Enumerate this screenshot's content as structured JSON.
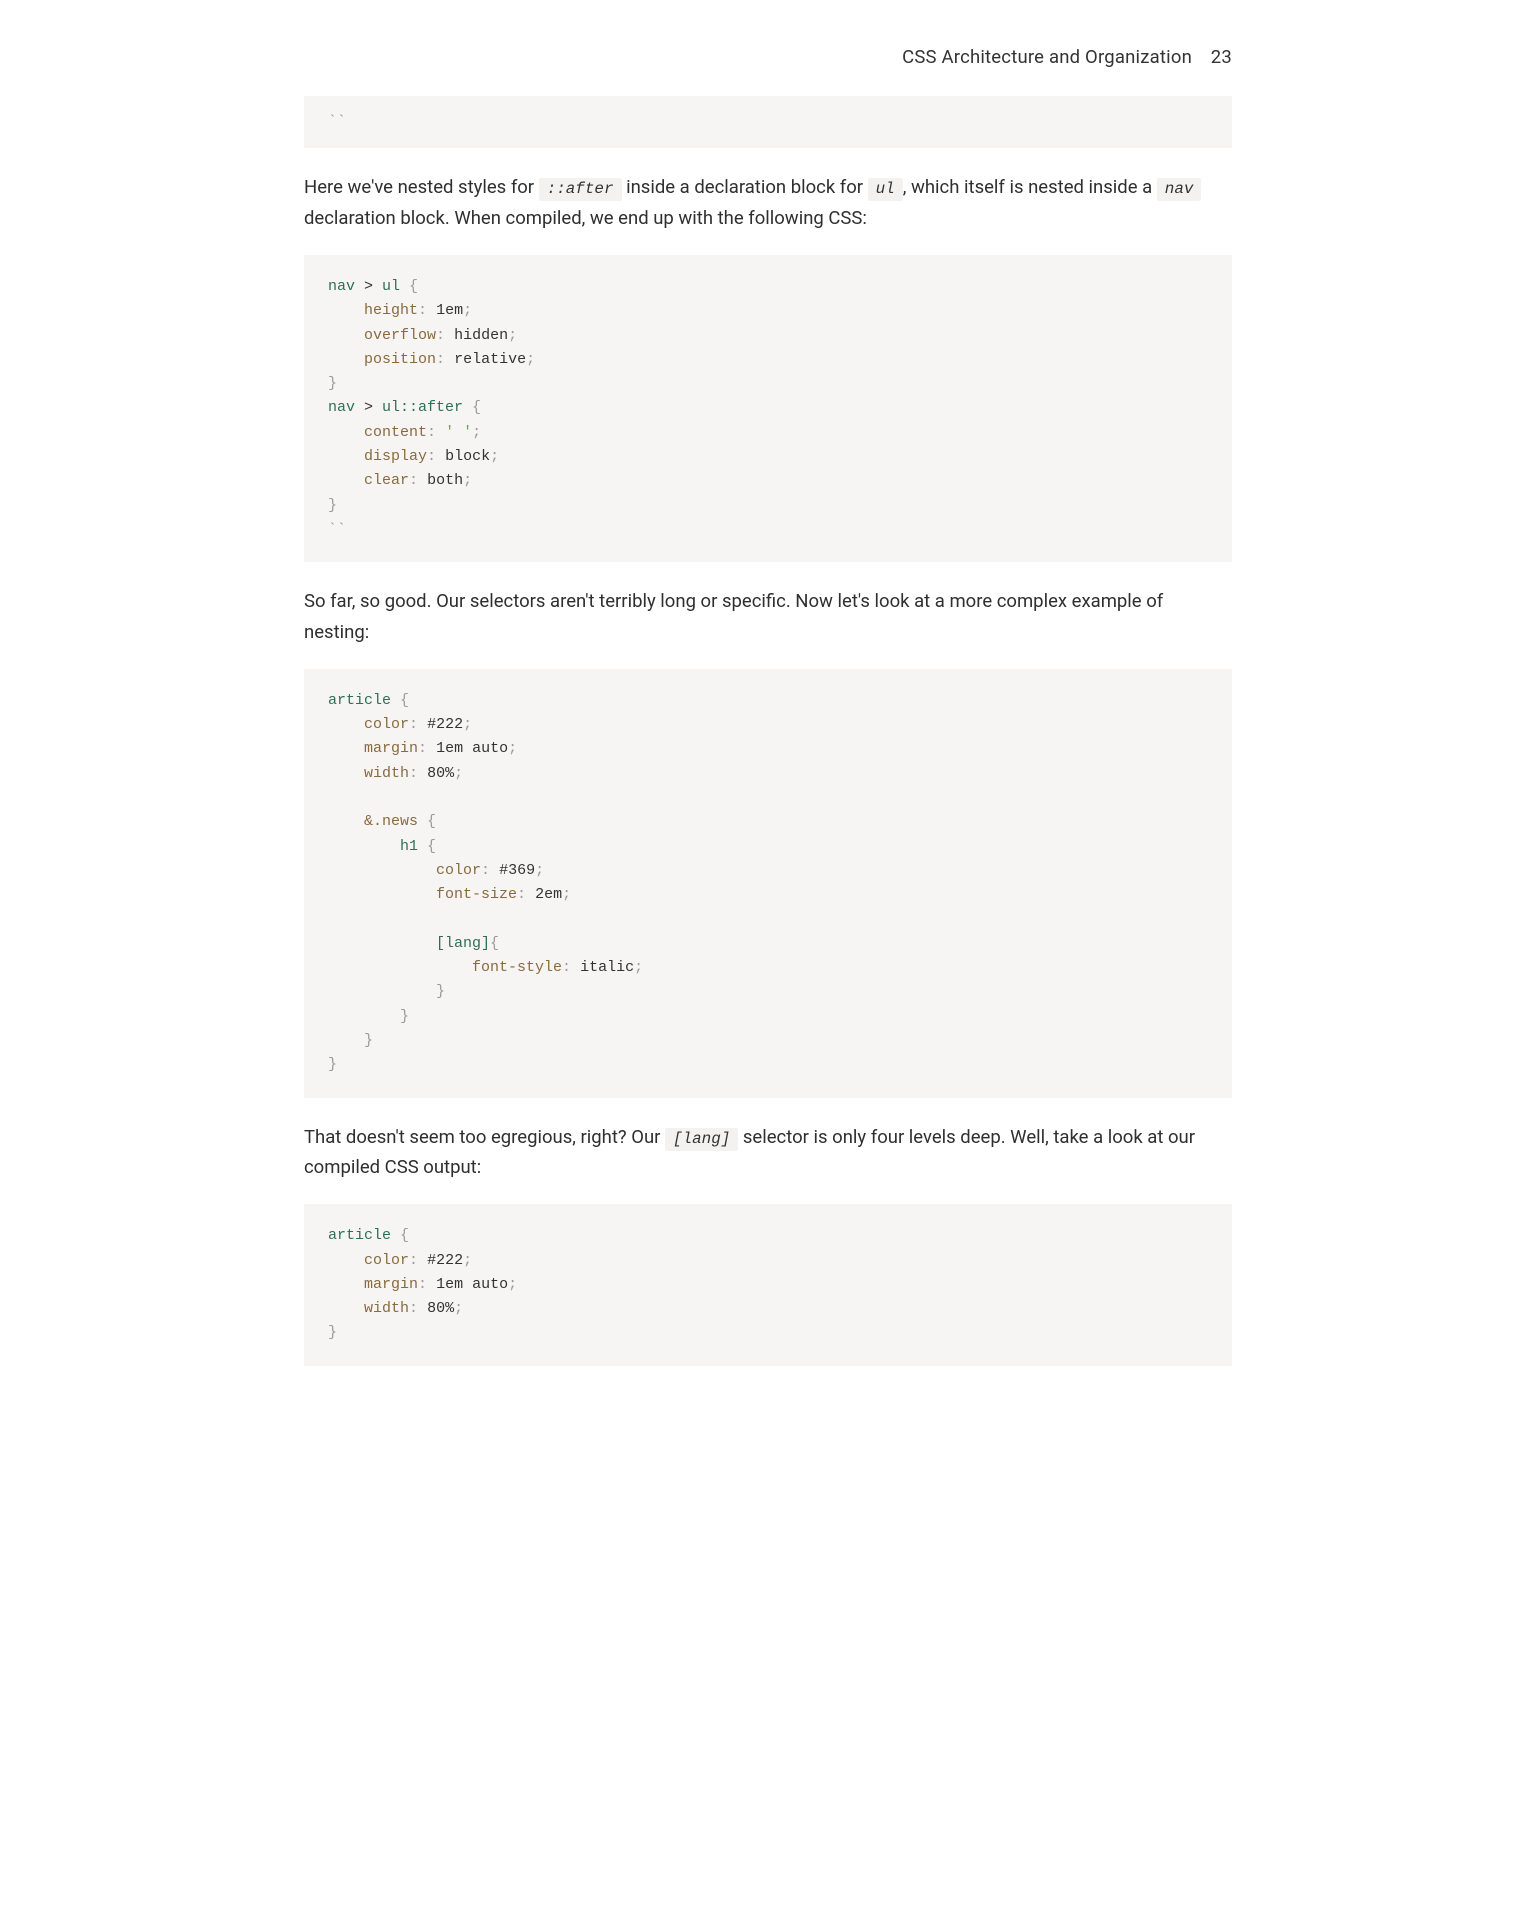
{
  "header": {
    "title": "CSS Architecture and Organization",
    "page_number": "23"
  },
  "block0_backticks": "``",
  "para1": {
    "t1": "Here we've nested styles for ",
    "c1": "::after",
    "t2": " inside a declaration block for ",
    "c2": "ul",
    "t3": ", which itself is nested inside a ",
    "c3": "nav",
    "t4": " declaration block. When compiled, we end up with the following CSS:"
  },
  "code1": {
    "sel1_a": "nav",
    "sel1_op": " > ",
    "sel1_b": "ul",
    "brace_o": " {",
    "indent": "    ",
    "p_height": "height",
    "v_height": "1em",
    "p_overflow": "overflow",
    "v_overflow": "hidden",
    "p_position": "position",
    "v_position": "relative",
    "brace_c": "}",
    "sel2_a": "nav",
    "sel2_op": " > ",
    "sel2_b": "ul::after",
    "p_content": "content",
    "v_content": "' '",
    "p_display": "display",
    "v_display": "block",
    "p_clear": "clear",
    "v_clear": "both",
    "backticks": "``"
  },
  "para2": "So far, so good. Our selectors aren't terribly long or specific. Now let's look at a more complex example of nesting:",
  "code2": {
    "sel_article": "article",
    "brace_o": " {",
    "p_color": "color",
    "v_color": "#222",
    "p_margin": "margin",
    "v_margin": "1em auto",
    "p_width": "width",
    "v_width": "80%",
    "amp": "&",
    "cls_news": ".news",
    "sel_h1": "h1",
    "p_color2": "color",
    "v_color2": "#369",
    "p_fs": "font-size",
    "v_fs": "2em",
    "attr_lang": "[lang]",
    "p_fstyle": "font-style",
    "v_fstyle": "italic",
    "brace_c": "}"
  },
  "para3": {
    "t1": "That doesn't seem too egregious, right? Our ",
    "c1": "[lang]",
    "t2": " selector is only four levels deep. Well, take a look at our compiled CSS output:"
  },
  "code3": {
    "sel_article": "article",
    "brace_o": " {",
    "p_color": "color",
    "v_color": "#222",
    "p_margin": "margin",
    "v_margin": "1em auto",
    "p_width": "width",
    "v_width": "80%",
    "brace_c": "}"
  },
  "tokens": {
    "colon": ":",
    "semi": ";",
    "sp": " "
  }
}
